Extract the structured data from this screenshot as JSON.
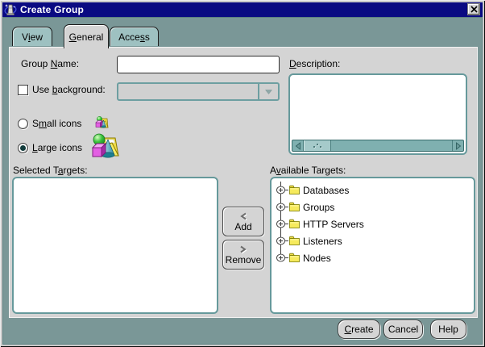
{
  "window": {
    "title": "Create Group"
  },
  "tabs": {
    "view": {
      "text": "View",
      "u": 1
    },
    "general": {
      "text": "General",
      "u": 0
    },
    "access": {
      "text": "Access",
      "u": 4
    }
  },
  "form": {
    "group_name_label": {
      "text": "Group Name:",
      "u": 6
    },
    "group_name_value": "",
    "use_background_label": {
      "text": "Use background:",
      "u": 4
    },
    "use_background_checked": false,
    "background_value": "",
    "small_icons_label": {
      "text": "Small icons",
      "u": 1
    },
    "large_icons_label": {
      "text": "Large icons",
      "u": 0
    },
    "icon_size_selected": "Large icons",
    "description_label": {
      "text": "Description:",
      "u": 0
    },
    "description_value": ""
  },
  "targets": {
    "selected_label": {
      "text": "Selected Targets:",
      "u": 10
    },
    "selected_items": [],
    "available_label": {
      "text": "Available Targets:",
      "u": 1
    },
    "add_label": "Add",
    "remove_label": "Remove",
    "tree": [
      {
        "label": "Databases"
      },
      {
        "label": "Groups"
      },
      {
        "label": "HTTP Servers"
      },
      {
        "label": "Listeners"
      },
      {
        "label": "Nodes"
      }
    ]
  },
  "buttons": {
    "create": {
      "text": "Create",
      "u": 0
    },
    "cancel_label": "Cancel",
    "help_label": "Help"
  },
  "icons": {
    "app_icon": "oracle-console-sparkle",
    "close_icon": "✕",
    "dropdown_arrow_icon": "▼",
    "add_chevron_icon": "❮",
    "remove_chevron_icon": "❯",
    "tree_expander_icon": "⊕",
    "folder_icon": "📁",
    "scroll_left_icon": "◀",
    "scroll_right_icon": "▶",
    "group_icon": "sphere-cone-cube-folder"
  },
  "colors": {
    "titlebar_navy": "#0a0a82",
    "dialog_teal": "#7a9797",
    "tab_teal": "#9ec1c1",
    "panel_gray": "#d4d4d4",
    "component_border_teal": "#66999b",
    "scrollbar_teal": "#7fb0b0",
    "folder_yellow": "#f6ea5c",
    "sphere_green": "#39c23c",
    "cube_magenta": "#e35fe3",
    "cone_teal": "#2e9aa8"
  }
}
